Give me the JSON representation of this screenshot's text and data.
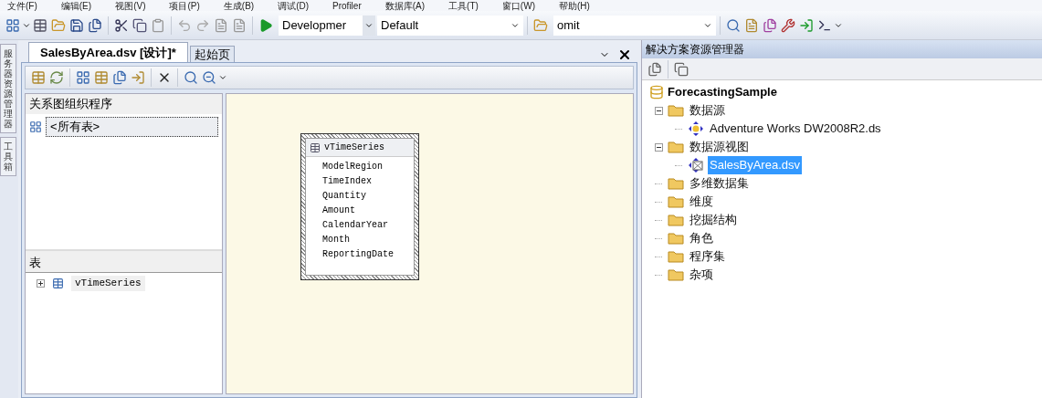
{
  "menu_bar": [
    "文件(F)",
    "编辑(E)",
    "视图(V)",
    "项目(P)",
    "生成(B)",
    "调试(D)",
    "Profiler",
    "数据库(A)",
    "工具(T)",
    "窗口(W)",
    "帮助(H)"
  ],
  "toolbar": {
    "configuration": "Developmer",
    "platform": "Default",
    "find": "omit"
  },
  "side_tabs": [
    "服务器资源管理器",
    "工具箱"
  ],
  "document_tabs": [
    {
      "label": "SalesByArea.dsv [设计]*",
      "selected": true
    },
    {
      "label": "起始页",
      "selected": false
    }
  ],
  "diagram_organizer": {
    "title": "关系图组织程序",
    "items": [
      {
        "label": "<所有表>",
        "selected": true
      }
    ]
  },
  "tables_pane": {
    "title": "表",
    "items": [
      {
        "label": "vTimeSeries",
        "expanded": false
      }
    ]
  },
  "canvas": {
    "table": {
      "title": "vTimeSeries",
      "selected": true,
      "columns": [
        "ModelRegion",
        "TimeIndex",
        "Quantity",
        "Amount",
        "CalendarYear",
        "Month",
        "ReportingDate"
      ]
    }
  },
  "solution_explorer": {
    "title": "解决方案资源管理器",
    "tree": {
      "label": "ForecastingSample",
      "children": [
        {
          "label": "数据源",
          "kind": "folder",
          "expanded": true,
          "selected": false,
          "children": [
            {
              "label": "Adventure Works DW2008R2.ds",
              "kind": "datasource",
              "selected": false
            }
          ]
        },
        {
          "label": "数据源视图",
          "kind": "folder",
          "expanded": true,
          "selected": false,
          "children": [
            {
              "label": "SalesByArea.dsv",
              "kind": "dsv",
              "selected": true
            }
          ]
        },
        {
          "label": "多维数据集",
          "kind": "folder",
          "expanded": false,
          "selected": false
        },
        {
          "label": "维度",
          "kind": "folder",
          "expanded": false,
          "selected": false
        },
        {
          "label": "挖掘结构",
          "kind": "folder",
          "expanded": false,
          "selected": false
        },
        {
          "label": "角色",
          "kind": "folder",
          "expanded": false,
          "selected": false
        },
        {
          "label": "程序集",
          "kind": "folder",
          "expanded": false,
          "selected": false
        },
        {
          "label": "杂项",
          "kind": "folder",
          "expanded": false,
          "selected": false
        }
      ]
    }
  }
}
